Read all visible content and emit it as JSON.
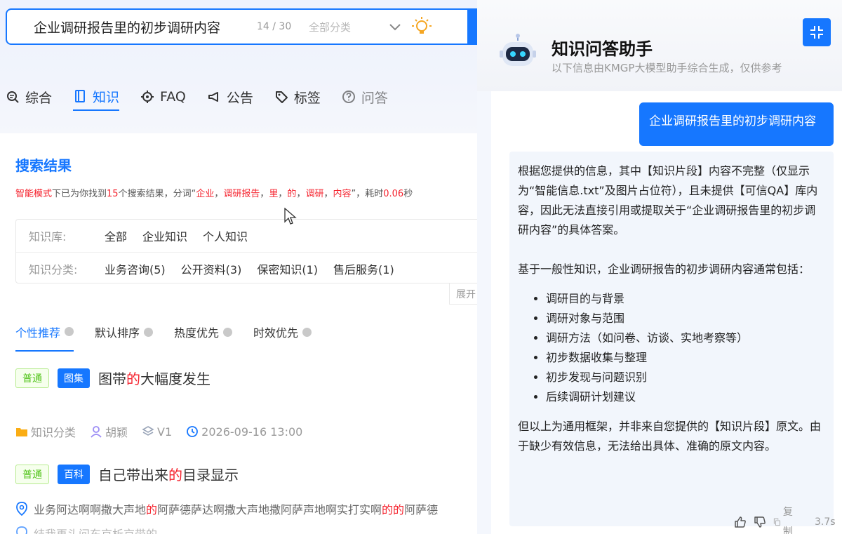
{
  "search": {
    "query": "企业调研报告里的初步调研内容",
    "count": "14 / 30",
    "category": "全部分类"
  },
  "tabs": [
    {
      "label": "综合"
    },
    {
      "label": "知识"
    },
    {
      "label": "FAQ"
    },
    {
      "label": "公告"
    },
    {
      "label": "标签"
    },
    {
      "label": "问答"
    }
  ],
  "results": {
    "title": "搜索结果",
    "summary": {
      "mode": "智能模式",
      "part1": "下已为你找到",
      "count": "15",
      "part2": "个搜索结果，分词“",
      "t1": "企业",
      "s1": "，",
      "t2": "调研报告",
      "s2": "，",
      "t3": "里",
      "s3": "，",
      "t4": "的",
      "s4": "，",
      "t5": "调研",
      "s5": "，",
      "t6": "内容",
      "part3": "”，耗时",
      "time": "0.06",
      "part4": "秒"
    }
  },
  "filters": {
    "kb_label": "知识库:",
    "kb_items": [
      "全部",
      "企业知识",
      "个人知识"
    ],
    "cat_label": "知识分类:",
    "cat_items": [
      "业务咨询(5)",
      "公开资料(3)",
      "保密知识(1)",
      "售后服务(1)"
    ],
    "expand": "展开"
  },
  "sort": [
    "个性推荐",
    "默认排序",
    "热度优先",
    "时效优先"
  ],
  "items": [
    {
      "tag1": "普通",
      "tag2": "图集",
      "title_a": "图带",
      "title_hl": "的",
      "title_b": "大幅度发生",
      "meta": {
        "category": "知识分类",
        "author": "胡颖",
        "version": "V1",
        "time": "2026-09-16 13:00"
      }
    },
    {
      "tag1": "普通",
      "tag2": "百科",
      "title_a": "自己带出来",
      "title_hl": "的",
      "title_b": "目录显示",
      "snippet_a": "业务阿达啊啊撒大声地",
      "snippet_h1": "的",
      "snippet_b": "阿萨德萨达啊撒大声地撒阿萨声地啊实打实啊",
      "snippet_h2": "的的",
      "snippet_c": "阿萨德",
      "snippet2": "结我再头问东京析京带的"
    }
  ],
  "assistant": {
    "title": "知识问答助手",
    "subtitle": "以下信息由KMGP大模型助手综合生成，仅供参考",
    "user_question": "企业调研报告里的初步调研内容",
    "answer_p1": "根据您提供的信息，其中【知识片段】内容不完整（仅显示为“智能信息.txt”及图片占位符），且未提供【可信QA】库内容，因此无法直接引用或提取关于“企业调研报告里的初步调研内容”的具体答案。",
    "answer_p2": "基于一般性知识，企业调研报告的初步调研内容通常包括：",
    "answer_list": [
      "调研目的与背景",
      "调研对象与范围",
      "调研方法（如问卷、访谈、实地考察等）",
      "初步数据收集与整理",
      "初步发现与问题识别",
      "后续调研计划建议"
    ],
    "answer_p3": "但以上为通用框架，并非来自您提供的【知识片段】原文。由于缺少有效信息，无法给出具体、准确的原文内容。",
    "copy_label": "复制",
    "elapsed": "3.7s"
  },
  "colors": {
    "accent": "#1677ff",
    "highlight": "#f5222d",
    "tag_green": "#52c41a"
  }
}
